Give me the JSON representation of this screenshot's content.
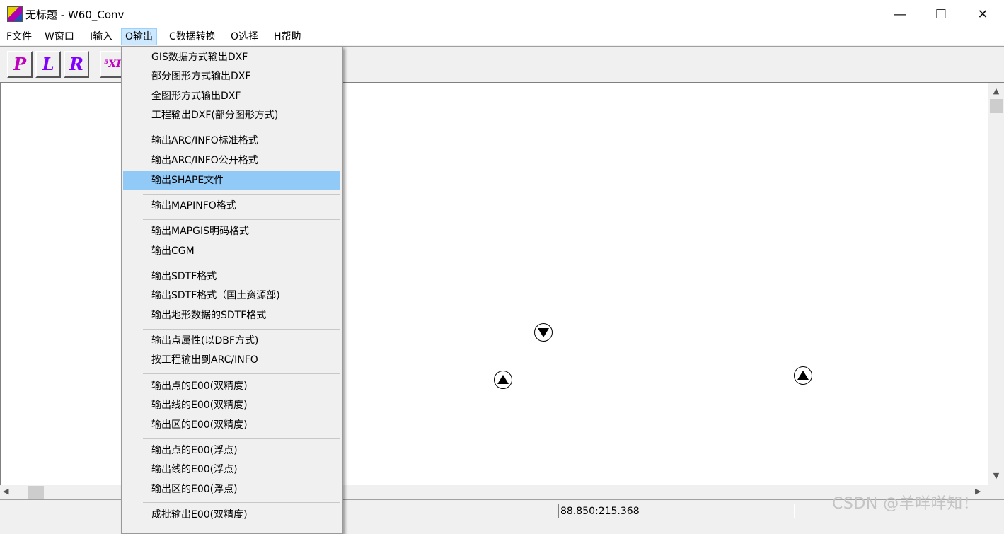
{
  "window": {
    "title": "无标题 - W60_Conv",
    "controls": {
      "minimize": "—",
      "maximize": "☐",
      "close": "✕"
    }
  },
  "menubar": {
    "items": [
      {
        "label": "F文件"
      },
      {
        "label": "W窗口"
      },
      {
        "label": "I输入"
      },
      {
        "label": "O输出",
        "open": true
      },
      {
        "label": "C数据转换"
      },
      {
        "label": "O选择"
      },
      {
        "label": "H帮助"
      }
    ]
  },
  "toolbar": {
    "buttons": [
      {
        "label": "P",
        "icon": "point-file-icon"
      },
      {
        "label": "L",
        "icon": "line-file-icon"
      },
      {
        "label": "R",
        "icon": "region-file-icon"
      },
      {
        "label": "⁵XI",
        "icon": "export-icon"
      }
    ]
  },
  "output_menu": {
    "items": [
      "GIS数据方式输出DXF",
      "部分图形方式输出DXF",
      "全图形方式输出DXF",
      "工程输出DXF(部分图形方式)",
      "输出ARC/INFO标准格式",
      "输出ARC/INFO公开格式",
      "输出SHAPE文件",
      "输出MAPINFO格式",
      "输出MAPGIS明码格式",
      "输出CGM",
      "输出SDTF格式",
      "输出SDTF格式（国土资源部)",
      "输出地形数据的SDTF格式",
      "输出点属性(以DBF方式)",
      "按工程输出到ARC/INFO",
      "输出点的E00(双精度)",
      "输出线的E00(双精度)",
      "输出区的E00(双精度)",
      "输出点的E00(浮点)",
      "输出线的E00(浮点)",
      "输出区的E00(浮点)",
      "成批输出E00(双精度)"
    ],
    "highlighted": "输出SHAPE文件"
  },
  "canvas": {
    "symbols": [
      {
        "name": "down-triangle-symbol"
      },
      {
        "name": "up-triangle-symbol"
      },
      {
        "name": "up-triangle-symbol"
      }
    ]
  },
  "statusbar": {
    "coordinates": "88.850:215.368"
  },
  "watermark": "CSDN @羊咩咩知！"
}
